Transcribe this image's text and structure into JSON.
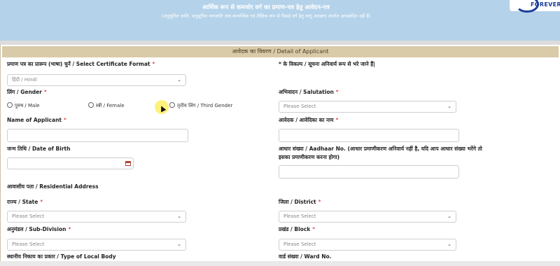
{
  "header": {
    "title": "आर्थिक रूप से कमजोर वर्ग का प्रमाण-पत्र हेतु आवेदन-पत्र",
    "subtitle": "(अनुसूचित जाति, अनुसूचित जनजाति तथा सामाजिक एवं शैक्षिक रूप से पिछड़े वर्ग हेतु लागू आरक्षण अंतर्गत आच्छादित नहीं हैं)",
    "logo_text": "FOREVER"
  },
  "section": {
    "title": "आवेदक का विवरण / Detail of Applicant"
  },
  "form": {
    "certificate_format": {
      "label": "प्रमाण पत्र का प्रारूप (भाषा) चुनें / Select Certificate Format",
      "value": "हिंदी / Hindi"
    },
    "mandatory_note": "* के विकल्प / सूचना अनिवार्य रूप से भरे जाने हैं|",
    "gender": {
      "label": "लिंग / Gender",
      "options": [
        "पुरुष / Male",
        "स्त्री / Female",
        "तृतीय लिंग / Third Gender"
      ]
    },
    "salutation": {
      "label": "अभिवादन / Salutation",
      "placeholder": "Please Select"
    },
    "applicant_name": {
      "label": "Name of Applicant",
      "value": ""
    },
    "applicant_name_hindi": {
      "label": "आवेदक / आवेदिका का नाम",
      "value": ""
    },
    "dob": {
      "label": "जन्म तिथि / Date of Birth",
      "value": ""
    },
    "aadhaar": {
      "label_line1": "आधार संख्या / Aadhaar No. (आधार प्रमाणीकरण अनिवार्य नहीं है, यदि आप आधार संख्या भरेंगे तो",
      "label_line2": "इसका प्रमाणीकरण करना होगा)",
      "value": ""
    },
    "residential_address": {
      "label": "आवासीय पता / Residential Address"
    },
    "state": {
      "label": "राज्य / State",
      "placeholder": "Please Select"
    },
    "district": {
      "label": "जिला / District",
      "placeholder": "Please Select"
    },
    "subdivision": {
      "label": "अनुमंडल / Sub-Division",
      "placeholder": "Please Select"
    },
    "block": {
      "label": "प्रखंड / Block",
      "placeholder": "Please Select"
    },
    "local_body": {
      "label": "स्थानीय निकाय का प्रकार / Type of Local Body"
    },
    "ward": {
      "label": "वार्ड संख्या / Ward No."
    }
  },
  "icons": {
    "dropdown": "chevron-down-icon",
    "calendar": "calendar-icon",
    "cursor": "mouse-cursor-icon"
  },
  "colors": {
    "header_bg": "#b4d2e9",
    "section_bar": "#d9caa8",
    "required": "#d02020"
  }
}
